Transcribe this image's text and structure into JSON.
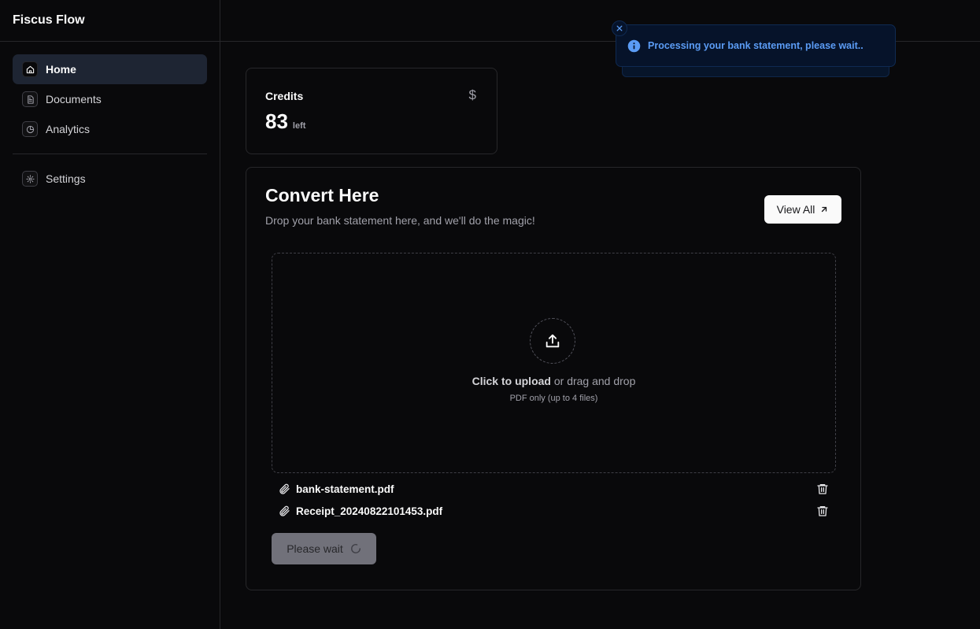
{
  "app": {
    "brand": "Fiscus Flow"
  },
  "sidebar": {
    "items": [
      {
        "label": "Home",
        "icon": "home-icon",
        "active": true
      },
      {
        "label": "Documents",
        "icon": "document-icon"
      },
      {
        "label": "Analytics",
        "icon": "pie-chart-icon"
      }
    ],
    "secondary": [
      {
        "label": "Settings",
        "icon": "gear-icon"
      }
    ]
  },
  "credits": {
    "label": "Credits",
    "symbol": "$",
    "value": "83",
    "suffix": "left"
  },
  "convert": {
    "title": "Convert Here",
    "subtitle": "Drop your bank statement here, and we'll do the magic!",
    "view_all_label": "View All",
    "dropzone": {
      "primary": "Click to upload",
      "secondary": " or drag and drop",
      "hint": "PDF only (up to 4 files)"
    },
    "files": [
      {
        "name": "bank-statement.pdf"
      },
      {
        "name": "Receipt_20240822101453.pdf"
      }
    ],
    "submit_label": "Please wait"
  },
  "toast": {
    "message": "Processing your bank statement, please wait.."
  },
  "colors": {
    "background": "#09090b",
    "border": "#27272a",
    "active_nav": "#1e2533",
    "toast_text": "#5b9cf5"
  }
}
